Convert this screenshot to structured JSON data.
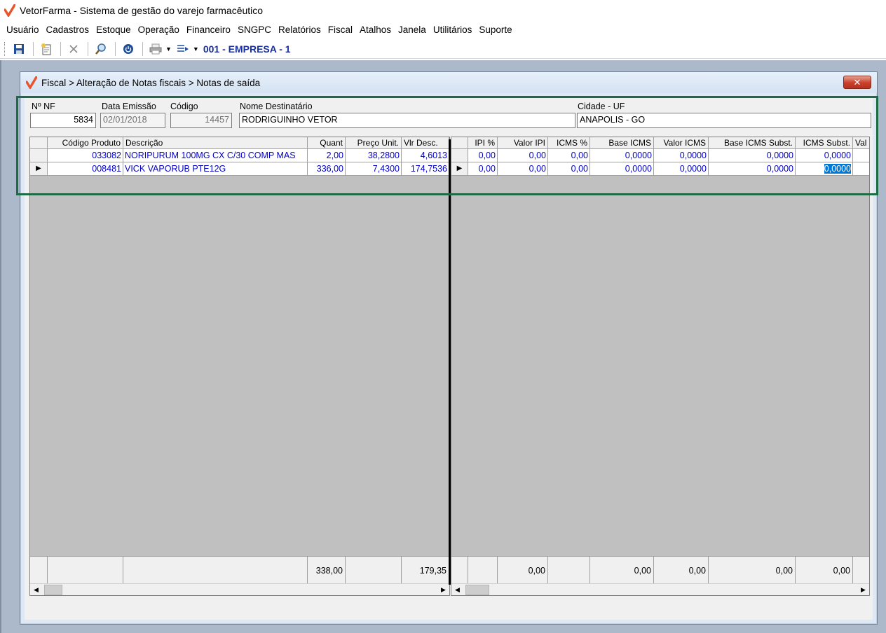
{
  "app": {
    "title": "VetorFarma - Sistema de gestão do varejo farmacêutico",
    "accent": "#e8542b"
  },
  "menu": [
    "Usuário",
    "Cadastros",
    "Estoque",
    "Operação",
    "Financeiro",
    "SNGPC",
    "Relatórios",
    "Fiscal",
    "Atalhos",
    "Janela",
    "Utilitários",
    "Suporte"
  ],
  "toolbar": {
    "company": "001 - EMPRESA - 1",
    "icons": [
      "save-icon",
      "new-document-icon",
      "delete-icon",
      "search-icon",
      "power-icon",
      "printer-icon",
      "list-icon"
    ]
  },
  "window": {
    "title": "Fiscal > Alteração de Notas fiscais > Notas de saída",
    "close_glyph": "✕"
  },
  "header": {
    "nf_label": "Nº NF",
    "nf_value": "5834",
    "date_label": "Data Emissão",
    "date_value": "02/01/2018",
    "code_label": "Código",
    "code_value": "14457",
    "name_label": "Nome Destinatário",
    "name_value": "RODRIGUINHO VETOR",
    "city_label": "Cidade - UF",
    "city_value": "ANAPOLIS - GO"
  },
  "left_grid": {
    "columns": [
      "",
      "Código Produto",
      "Descrição",
      "Quant",
      "Preço Unit.",
      "Vlr Desc."
    ],
    "rows": [
      {
        "indicator": "",
        "code": "033082",
        "desc": "NORIPURUM 100MG CX C/30 COMP MAS",
        "qty": "2,00",
        "price": "38,2800",
        "disc": "4,6013"
      },
      {
        "indicator": "▶",
        "code": "008481",
        "desc": "VICK VAPORUB PTE12G",
        "qty": "336,00",
        "price": "7,4300",
        "disc": "174,7536"
      }
    ],
    "totals": {
      "qty": "338,00",
      "disc": "179,35"
    }
  },
  "right_grid": {
    "columns": [
      "",
      "IPI %",
      "Valor IPI",
      "ICMS %",
      "Base ICMS",
      "Valor ICMS",
      "Base ICMS Subst.",
      "ICMS Subst.",
      "Val"
    ],
    "rows": [
      {
        "indicator": "",
        "ipi_pct": "0,00",
        "ipi_val": "0,00",
        "icms_pct": "0,00",
        "base_icms": "0,0000",
        "val_icms": "0,0000",
        "base_subst": "0,0000",
        "icms_subst": "0,0000"
      },
      {
        "indicator": "▶",
        "ipi_pct": "0,00",
        "ipi_val": "0,00",
        "icms_pct": "0,00",
        "base_icms": "0,0000",
        "val_icms": "0,0000",
        "base_subst": "0,0000",
        "icms_subst": "0,0000"
      }
    ],
    "totals": {
      "ipi_val": "0,00",
      "base_icms": "0,00",
      "val_icms": "0,00",
      "base_subst": "0,00",
      "icms_subst": "0,00"
    }
  }
}
